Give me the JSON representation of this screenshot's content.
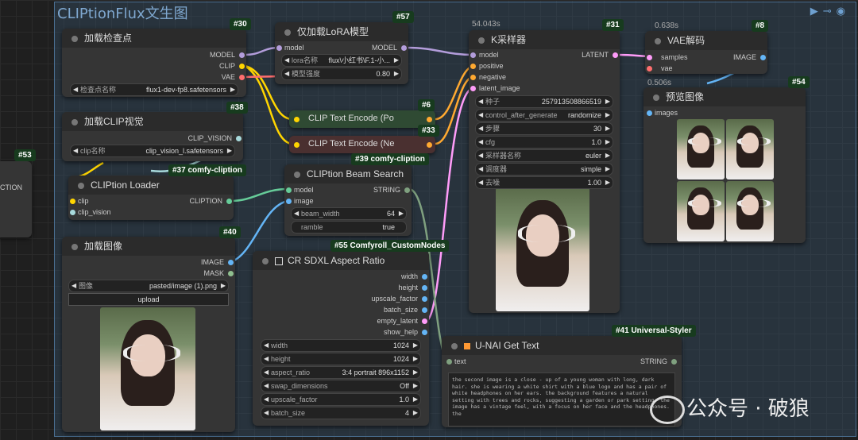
{
  "group": {
    "title": "CLIPtionFlux文生图"
  },
  "nodes": {
    "ckpt": {
      "badge": "#30",
      "title": "加载检查点",
      "out_model": "MODEL",
      "out_clip": "CLIP",
      "out_vae": "VAE",
      "widget_label": "检查点名称",
      "widget_value": "flux1-dev-fp8.safetensors"
    },
    "lora": {
      "badge": "#57",
      "title": "仅加载LoRA模型",
      "in_model": "model",
      "out_model": "MODEL",
      "w1_label": "lora名称",
      "w1_value": "flux\\小红书\\F.1-小...",
      "w2_label": "模型强度",
      "w2_value": "0.80"
    },
    "clipvision": {
      "badge": "#38",
      "title": "加载CLIP视觉",
      "out": "CLIP_VISION",
      "widget_label": "clip名称",
      "widget_value": "clip_vision_l.safetensors"
    },
    "enc_pos": {
      "badge": "#6",
      "title": "CLIP Text Encode (Po"
    },
    "enc_neg": {
      "badge": "#33",
      "title": "CLIP Text Encode (Ne"
    },
    "ksampler": {
      "badge": "#31",
      "timing": "54.043s",
      "title": "K采样器",
      "in_model": "model",
      "in_positive": "positive",
      "in_negative": "negative",
      "in_latent": "latent_image",
      "out": "LATENT",
      "widgets": [
        {
          "label": "种子",
          "value": "257913508866519"
        },
        {
          "label": "control_after_generate",
          "value": "randomize"
        },
        {
          "label": "步骤",
          "value": "30"
        },
        {
          "label": "cfg",
          "value": "1.0"
        },
        {
          "label": "采样器名称",
          "value": "euler"
        },
        {
          "label": "调度器",
          "value": "simple"
        },
        {
          "label": "去噪",
          "value": "1.00"
        }
      ]
    },
    "vae": {
      "badge": "#8",
      "timing": "0.638s",
      "title": "VAE解码",
      "in_samples": "samples",
      "in_vae": "vae",
      "out": "IMAGE"
    },
    "preview": {
      "badge": "#54",
      "timing": "0.506s",
      "title": "预览图像",
      "in": "images"
    },
    "n53": {
      "badge": "#53",
      "partial": "CTION"
    },
    "loader": {
      "badge": "#37 comfy-cliption",
      "title": "CLIPtion Loader",
      "in_clip": "clip",
      "in_clipvision": "clip_vision",
      "out": "CLIPTION"
    },
    "beam": {
      "badge": "#39 comfy-cliption",
      "title": "CLIPtion Beam Search",
      "in_model": "model",
      "in_image": "image",
      "out": "STRING",
      "w1_label": "beam_width",
      "w1_value": "64",
      "w2_label": "ramble",
      "w2_value": "true"
    },
    "loadimg": {
      "badge": "#40",
      "title": "加载图像",
      "out_image": "IMAGE",
      "out_mask": "MASK",
      "widget_label": "图像",
      "widget_value": "pasted/image (1).png",
      "upload": "upload"
    },
    "aspect": {
      "badge": "#55 Comfyroll_CustomNodes",
      "title": "CR SDXL Aspect Ratio",
      "outs": [
        "width",
        "height",
        "upscale_factor",
        "batch_size",
        "empty_latent",
        "show_help"
      ],
      "widgets": [
        {
          "label": "width",
          "value": "1024"
        },
        {
          "label": "height",
          "value": "1024"
        },
        {
          "label": "aspect_ratio",
          "value": "3:4 portrait 896x1152"
        },
        {
          "label": "swap_dimensions",
          "value": "Off"
        },
        {
          "label": "upscale_factor",
          "value": "1.0"
        },
        {
          "label": "batch_size",
          "value": "4"
        }
      ]
    },
    "unai": {
      "badge": "#41 Universal-Styler",
      "title": "U-NAI Get Text",
      "in": "text",
      "out": "STRING",
      "text": "the second image is a close - up of a young woman with long, dark hair. she is wearing a white shirt with a blue logo and has a pair of white headphones on her ears. the background features a natural setting with trees and rocks, suggesting a garden or park setting. the image has a vintage feel, with a focus on her face and the headphones. the"
    }
  },
  "watermark": "公众号 · 破狼",
  "colors": {
    "model": "#b39ddb",
    "clip": "#ffd500",
    "vae": "#ff6e6e",
    "conditioning": "#ffa931",
    "latent": "#ff9cf9",
    "image": "#64b5f6",
    "clip_vision": "#a8dadc",
    "string": "#7fa07f",
    "cliption": "#66cc99"
  }
}
